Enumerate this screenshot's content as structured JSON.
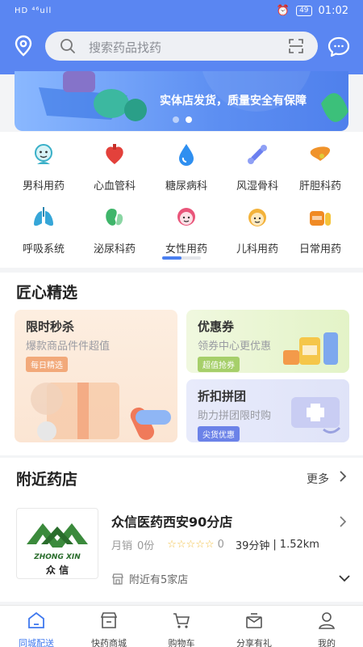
{
  "status_bar": {
    "left": "HD ⁴⁶ull",
    "battery": "49",
    "time": "01:02"
  },
  "search": {
    "placeholder": "搜索药品找药"
  },
  "banner": {
    "slogan": "实体店发货，质量安全有保障"
  },
  "categories": [
    {
      "label": "男科用药",
      "icon": "male-icon",
      "color": "#3ab0c8"
    },
    {
      "label": "心血管科",
      "icon": "heart-icon",
      "color": "#e3413b"
    },
    {
      "label": "糖尿病科",
      "icon": "drop-icon",
      "color": "#2f8ff0"
    },
    {
      "label": "风湿骨科",
      "icon": "bone-icon",
      "color": "#6b7ff0"
    },
    {
      "label": "肝胆科药",
      "icon": "liver-icon",
      "color": "#f0932b"
    },
    {
      "label": "呼吸系统",
      "icon": "lung-icon",
      "color": "#36a6d8"
    },
    {
      "label": "泌尿科药",
      "icon": "kidney-icon",
      "color": "#3fb56a"
    },
    {
      "label": "女性用药",
      "icon": "female-icon",
      "color": "#e9557a"
    },
    {
      "label": "儿科用药",
      "icon": "child-icon",
      "color": "#f3b23a"
    },
    {
      "label": "日常用药",
      "icon": "pill-icon",
      "color": "#f08a24"
    }
  ],
  "curated": {
    "title": "匠心精选",
    "flash": {
      "title": "限时秒杀",
      "subtitle": "爆款商品件件超值",
      "tag": "每日精选"
    },
    "coupon": {
      "title": "优惠券",
      "subtitle": "领券中心更优惠",
      "tag": "超值抢券"
    },
    "group": {
      "title": "折扣拼团",
      "subtitle": "助力拼团限时购",
      "tag": "尖货优惠"
    }
  },
  "nearby": {
    "title": "附近药店",
    "more": "更多",
    "store": {
      "name": "众信医药西安90分店",
      "logo_en": "ZHONG XIN",
      "logo_cn": "众 信",
      "sales_label": "月销",
      "sales": "0份",
      "stars": "☆☆☆☆☆",
      "rating": "0",
      "eta": "39分钟",
      "sep": "|",
      "distance": "1.52km"
    },
    "note": "附近有5家店"
  },
  "tabs": [
    {
      "label": "同城配送",
      "icon": "home-icon",
      "active": true
    },
    {
      "label": "快药商城",
      "icon": "shop-icon"
    },
    {
      "label": "购物车",
      "icon": "cart-icon"
    },
    {
      "label": "分享有礼",
      "icon": "gift-icon"
    },
    {
      "label": "我的",
      "icon": "user-icon"
    }
  ],
  "colors": {
    "accent": "#5a86f2",
    "active_tab": "#3f78ee",
    "star": "#f2c24a"
  }
}
